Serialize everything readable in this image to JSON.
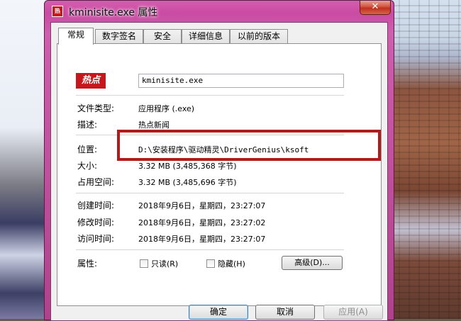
{
  "window": {
    "title": "kminisite.exe 属性",
    "close_label": "✕"
  },
  "tabs": [
    {
      "label": "常规",
      "active": true
    },
    {
      "label": "数字签名",
      "active": false
    },
    {
      "label": "安全",
      "active": false
    },
    {
      "label": "详细信息",
      "active": false
    },
    {
      "label": "以前的版本",
      "active": false
    }
  ],
  "general": {
    "icon_text": "热点",
    "file_name": "kminisite.exe",
    "file_type_label": "文件类型:",
    "file_type_value": "应用程序 (.exe)",
    "description_label": "描述:",
    "description_value": "热点新闻",
    "location_label": "位置:",
    "location_value": "D:\\安装程序\\驱动精灵\\DriverGenius\\ksoft",
    "size_label": "大小:",
    "size_value": "3.32 MB (3,485,368 字节)",
    "size_on_disk_label": "占用空间:",
    "size_on_disk_value": "3.32 MB (3,485,696 字节)",
    "created_label": "创建时间:",
    "created_value": "2018年9月6日，星期四，23:27:07",
    "modified_label": "修改时间:",
    "modified_value": "2018年9月6日，星期四，23:27:02",
    "accessed_label": "访问时间:",
    "accessed_value": "2018年9月6日，星期四，23:27:07",
    "attributes_label": "属性:",
    "readonly_label": "只读(R)",
    "hidden_label": "隐藏(H)",
    "advanced_label": "高级(D)..."
  },
  "buttons": {
    "ok": "确定",
    "cancel": "取消",
    "apply": "应用(A)"
  },
  "colors": {
    "highlight_box": "#b01c1c",
    "title_bar": "#c94ba3"
  }
}
